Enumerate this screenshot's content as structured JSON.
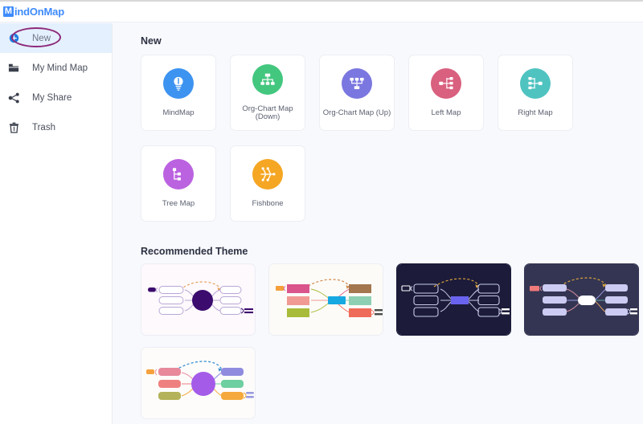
{
  "app": {
    "logo_badge": "M",
    "logo_text": "indOnMap",
    "logo_full": "MindOnMap"
  },
  "sidebar": {
    "items": [
      {
        "label": "New",
        "icon": "plus-circle-icon",
        "active": true,
        "annotated": true
      },
      {
        "label": "My Mind Map",
        "icon": "folder-icon",
        "active": false,
        "annotated": false
      },
      {
        "label": "My Share",
        "icon": "share-icon",
        "active": false,
        "annotated": false
      },
      {
        "label": "Trash",
        "icon": "trash-icon",
        "active": false,
        "annotated": false
      }
    ],
    "active_bg": "#e4f0fd",
    "annotation_color": "#8e2a7a"
  },
  "main": {
    "new_section_title": "New",
    "theme_section_title": "Recommended Theme",
    "new_cards": [
      {
        "label": "MindMap",
        "icon": "lightbulb-icon",
        "color": "#3d93f0"
      },
      {
        "label": "Org-Chart Map (Down)",
        "icon": "org-chart-down-icon",
        "color": "#43c77f"
      },
      {
        "label": "Org-Chart Map (Up)",
        "icon": "org-chart-up-icon",
        "color": "#7b77e0"
      },
      {
        "label": "Left Map",
        "icon": "left-map-icon",
        "color": "#d9607f"
      },
      {
        "label": "Right Map",
        "icon": "right-map-icon",
        "color": "#4fc3c0"
      },
      {
        "label": "Tree Map",
        "icon": "tree-map-icon",
        "color": "#bb62e0"
      },
      {
        "label": "Fishbone",
        "icon": "fishbone-icon",
        "color": "#f5a623"
      }
    ],
    "themes": [
      {
        "name": "theme-light-purple",
        "bg": "#fdf9fc",
        "center_shape": "circle",
        "center_color": "#3b0b6e",
        "node_fill": "#ffffff",
        "node_stroke": "#b9a7d6",
        "link_color": "#b9a7d6",
        "arrow_color": "#f0a050",
        "tag_color": "#3b0b6e"
      },
      {
        "name": "theme-light-colorful-rect",
        "bg": "#fcfbf8",
        "center_shape": "rect",
        "center_color": "#16a8e0",
        "node_colors": [
          "#d9558c",
          "#a3764f",
          "#f19a94",
          "#8ecfb4",
          "#a8bb3a",
          "#ef6b5a"
        ],
        "tag_color": "#f5a03c",
        "arrow_color": "#d08a4a"
      },
      {
        "name": "theme-dark-navy",
        "bg": "#1c1b3a",
        "center_shape": "rect",
        "center_color": "#6a63ef",
        "node_fill": "#1c1b3a",
        "node_stroke": "#c9cbe8",
        "link_color": "#c9cbe8",
        "arrow_color": "#d8a23e",
        "tag_color": "#ffffff"
      },
      {
        "name": "theme-dark-slate",
        "bg": "#343552",
        "center_shape": "rect",
        "center_color": "#ffffff",
        "node_fill": "#ccccf2",
        "link_colors": [
          "#d08aa0",
          "#9a9ae0",
          "#5fa8a0",
          "#e0a060"
        ],
        "arrow_color": "#d8a23e",
        "tag_color": "#ef7a7a"
      },
      {
        "name": "theme-light-purple-circle",
        "bg": "#fdfcfb",
        "center_shape": "circle",
        "center_color": "#a45ce8",
        "node_colors": [
          "#e8899c",
          "#8f8ce0",
          "#ef8080",
          "#6ecfa0",
          "#b4b25a",
          "#f5a93c"
        ],
        "tag_color": "#f5a03c",
        "arrow_color": "#3a8fd0"
      }
    ]
  }
}
